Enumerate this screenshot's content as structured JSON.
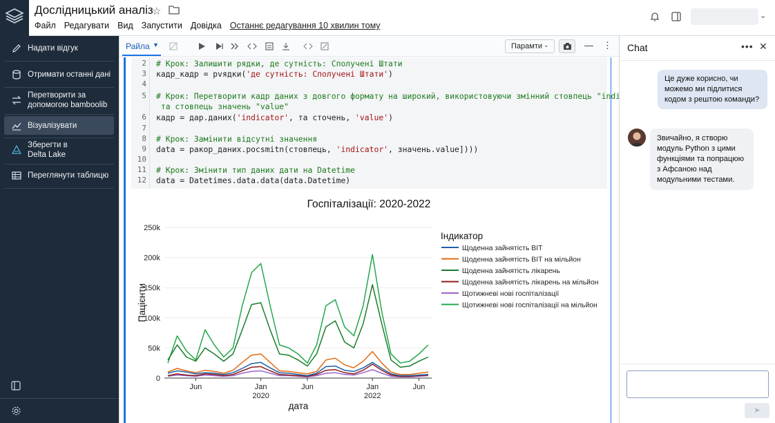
{
  "app": {
    "title": "Дослідницький аналіз",
    "menu": [
      "Файл",
      "Редагувати",
      "Вид",
      "Запустити",
      "Довідка"
    ],
    "last_edit": "Останнє редагування 10 хвилин тому"
  },
  "sidebar": {
    "items": [
      {
        "label": "Надати відгук",
        "icon": "pencil-icon"
      },
      {
        "label": "Отримати останні дані",
        "icon": "database-icon"
      },
      {
        "label": "Перетворити за допомогою bamboolib",
        "icon": "transform-icon"
      },
      {
        "label": "Візуалізувати",
        "icon": "chart-line-icon"
      },
      {
        "label": "Зберегти в Delta Lake",
        "icon": "delta-icon"
      },
      {
        "label": "Переглянути таблицю",
        "icon": "table-icon"
      }
    ]
  },
  "toolbar": {
    "kernel": "Райла",
    "params": "Парамти"
  },
  "code": {
    "lines": [
      {
        "n": "2",
        "parts": [
          {
            "t": "# Крок: Залишити рядки, де сутність: Сполучені Штати",
            "c": "cm"
          }
        ]
      },
      {
        "n": "3",
        "parts": [
          {
            "t": "кадр_кадр = рvядки(",
            "c": ""
          },
          {
            "t": "'де сутність: Сполучені Штати'",
            "c": "st"
          },
          {
            "t": ")",
            "c": ""
          }
        ]
      },
      {
        "n": "4",
        "parts": []
      },
      {
        "n": "5",
        "parts": [
          {
            "t": "# Крок: Перетворити кадр даних з довгого формату на широкий, використовуючи змінний стовпець \"indicator\"",
            "c": "cm"
          }
        ]
      },
      {
        "n": "",
        "parts": [
          {
            "t": " та стовпець значень \"value\"",
            "c": "cm"
          }
        ]
      },
      {
        "n": "6",
        "parts": [
          {
            "t": "кадр = дар.даних(",
            "c": ""
          },
          {
            "t": "'indicator'",
            "c": "st"
          },
          {
            "t": ", та сточень, ",
            "c": ""
          },
          {
            "t": "'value'",
            "c": "st"
          },
          {
            "t": ")",
            "c": ""
          }
        ]
      },
      {
        "n": "7",
        "parts": []
      },
      {
        "n": "8",
        "parts": [
          {
            "t": "# Крок: Замінити відсутні значення",
            "c": "cm"
          }
        ]
      },
      {
        "n": "9",
        "parts": [
          {
            "t": "data = ракор_даних.роcsmitn(стовпець, ",
            "c": ""
          },
          {
            "t": "'indicator'",
            "c": "st"
          },
          {
            "t": ", значень.value])))",
            "c": ""
          }
        ]
      },
      {
        "n": "10",
        "parts": []
      },
      {
        "n": "11",
        "parts": [
          {
            "t": "# Крок: Змінити тип даних дати на Datetime",
            "c": "cm"
          }
        ]
      },
      {
        "n": "12",
        "parts": [
          {
            "t": "data = Datetimes.data.data(data.Datetime)",
            "c": ""
          }
        ]
      }
    ]
  },
  "chart_data": {
    "type": "line",
    "title": "Госпіталізації: 2020-2022",
    "xlabel": "дата",
    "ylabel": "Пацієнти",
    "ylim": [
      0,
      250000
    ],
    "y_ticks": [
      "0",
      "50k",
      "100k",
      "150k",
      "200k",
      "250k"
    ],
    "x_ticks": [
      {
        "top": "Jun",
        "bottom": ""
      },
      {
        "top": "Jan",
        "bottom": "2020"
      },
      {
        "top": "Jun",
        "bottom": ""
      },
      {
        "top": "Jan",
        "bottom": "2022"
      },
      {
        "top": "Jun",
        "bottom": ""
      }
    ],
    "x": [
      "2020-03",
      "2020-04",
      "2020-05",
      "2020-06",
      "2020-07",
      "2020-08",
      "2020-09",
      "2020-10",
      "2020-11",
      "2020-12",
      "2021-01",
      "2021-02",
      "2021-03",
      "2021-04",
      "2021-05",
      "2021-06",
      "2021-07",
      "2021-08",
      "2021-09",
      "2021-10",
      "2021-11",
      "2021-12",
      "2022-01",
      "2022-02",
      "2022-03",
      "2022-04",
      "2022-05",
      "2022-06",
      "2022-07"
    ],
    "legend_title": "Індикатор",
    "legend_position": "right",
    "series": [
      {
        "name": "Щоденна зайнятість BIT",
        "color": "#1f5fa8",
        "values": [
          8000,
          12000,
          10000,
          7000,
          9000,
          8000,
          6000,
          9000,
          16000,
          24000,
          26000,
          17000,
          9000,
          8000,
          6000,
          4000,
          8000,
          19000,
          20000,
          13000,
          11000,
          17000,
          26000,
          16000,
          7000,
          4000,
          4000,
          5000,
          6000
        ]
      },
      {
        "name": "Щоденна зайнятість BIT на мільйон",
        "color": "#e06a10",
        "values": [
          10000,
          16000,
          12000,
          9000,
          13000,
          11000,
          8000,
          13000,
          26000,
          38000,
          40000,
          26000,
          12000,
          11000,
          9000,
          7000,
          11000,
          30000,
          33000,
          22000,
          17000,
          28000,
          44000,
          25000,
          10000,
          6000,
          6000,
          8000,
          10000
        ]
      },
      {
        "name": "Щоденна зайнятість лікарень",
        "color": "#1a7d2a",
        "values": [
          30000,
          55000,
          35000,
          28000,
          50000,
          40000,
          28000,
          40000,
          80000,
          122000,
          125000,
          80000,
          40000,
          38000,
          30000,
          20000,
          40000,
          85000,
          95000,
          60000,
          50000,
          90000,
          155000,
          90000,
          30000,
          18000,
          20000,
          28000,
          35000
        ]
      },
      {
        "name": "Щоденна зайнятість лікарень на мільйон",
        "color": "#8b1c1c",
        "values": [
          4000,
          7000,
          5000,
          4000,
          7000,
          6000,
          4000,
          6000,
          12000,
          18000,
          19000,
          12000,
          6000,
          5000,
          4000,
          3000,
          6000,
          13000,
          14000,
          9000,
          7000,
          13000,
          23000,
          13000,
          5000,
          3000,
          3000,
          4000,
          5000
        ]
      },
      {
        "name": "Щотижневі нові госпіталізації",
        "color": "#9a63c9",
        "values": [
          3000,
          5000,
          4000,
          3000,
          5000,
          4000,
          3000,
          4000,
          8000,
          11000,
          12000,
          8000,
          4000,
          4000,
          3000,
          2000,
          4000,
          8000,
          9000,
          6000,
          5000,
          9000,
          14000,
          8000,
          3000,
          2000,
          2000,
          3000,
          4000
        ]
      },
      {
        "name": "Щотижневі нові госпіталізації на мільйон",
        "color": "#22a84a",
        "values": [
          25000,
          70000,
          45000,
          30000,
          80000,
          55000,
          35000,
          50000,
          120000,
          175000,
          190000,
          120000,
          55000,
          50000,
          40000,
          25000,
          55000,
          120000,
          130000,
          85000,
          70000,
          120000,
          205000,
          110000,
          40000,
          25000,
          28000,
          40000,
          55000
        ]
      }
    ]
  },
  "chat": {
    "title": "Chat",
    "user_message": "Це дуже корисно, чи можемо ми підлитися кодом з рештою команди?",
    "ai_message": "Звичайно, я створю модуль Python з цими функціями та попрацюю з Афсаною над модульними тестами.",
    "send_label": "➤"
  }
}
